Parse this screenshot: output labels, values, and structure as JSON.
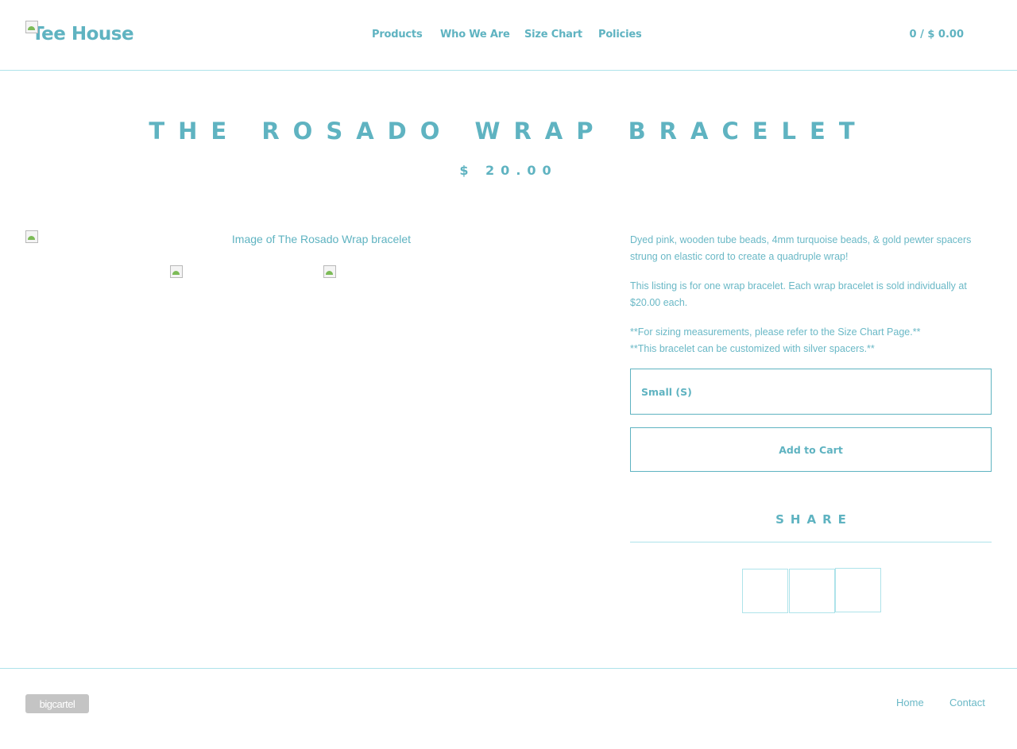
{
  "header": {
    "logo_text": "Tee House",
    "nav": [
      "Products",
      "Who We Are",
      "Size Chart",
      "Policies"
    ],
    "cart": "0 / $ 0.00"
  },
  "product": {
    "title": "THE ROSADO WRAP BRACELET",
    "price": "$ 20.00",
    "image_alt": "Image of The Rosado Wrap bracelet",
    "description": [
      "Dyed pink, wooden tube beads, 4mm turquoise beads, & gold pewter spacers strung on elastic cord to create a quadruple wrap!",
      "This listing is for one wrap bracelet. Each wrap bracelet is sold individually at $20.00 each.",
      "**For sizing measurements, please refer to the Size Chart Page.**",
      "**This bracelet can be customized with silver spacers.**"
    ],
    "option_selected": "Small (S)",
    "add_to_cart": "Add to Cart"
  },
  "share": {
    "title": "SHARE"
  },
  "footer": {
    "badge": "bigcartel",
    "links": [
      "Home",
      "Contact"
    ]
  },
  "colors": {
    "accent": "#5fb3c1",
    "divider": "#aee3ea",
    "badge_bg": "#c4c4c4"
  }
}
